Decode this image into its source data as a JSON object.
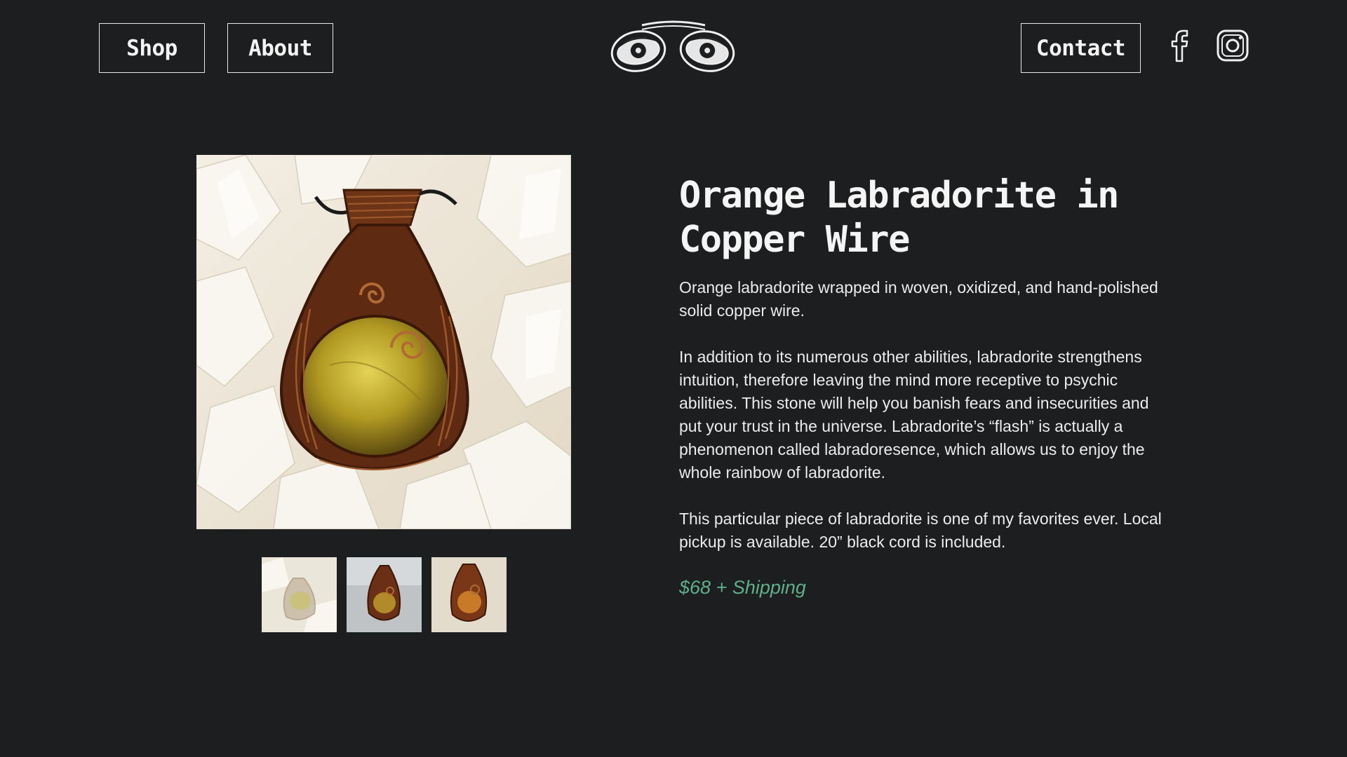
{
  "header": {
    "nav": {
      "shop": "Shop",
      "about": "About",
      "contact": "Contact"
    },
    "logo_icon": "eyes-logo-icon",
    "social": [
      {
        "icon": "facebook-icon"
      },
      {
        "icon": "instagram-icon"
      }
    ]
  },
  "product": {
    "title_line1": "Orange Labradorite in",
    "title_line2": "Copper Wire",
    "description": [
      "Orange labradorite wrapped in woven, oxidized, and hand-polished solid copper wire.",
      "In addition to its numerous other abilities, labradorite strengthens intuition, therefore leaving the mind more receptive to psychic abilities. This stone will help you banish fears and insecurities and put your trust in the universe. Labradorite’s “flash” is actually a phenomenon called labradoresence, which allows us to enjoy the whole rainbow of labradorite.",
      "This particular piece of labradorite is one of my favorites ever. Local pickup is available. 20” black cord is included."
    ],
    "price": "$68 + Shipping",
    "thumbnail_count": 3
  },
  "colors": {
    "background": "#1d1e20",
    "text": "#f2f2f2",
    "price": "#5fae8a",
    "copper": "#7a3d1c",
    "stone": "#b8a22a"
  }
}
